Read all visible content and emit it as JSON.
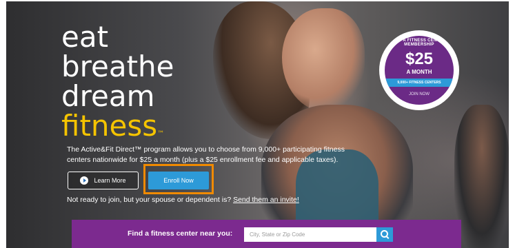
{
  "hero": {
    "headline": {
      "line1": "eat",
      "line2": "breathe",
      "line3": "dream",
      "line4": "fitness",
      "trademark": "™"
    },
    "promo_text": "The Active&Fit Direct™ program allows you to choose from 9,000+ participating fitness centers nationwide for $25 a month (plus a $25 enrollment fee and applicable taxes).",
    "learn_more_label": "Learn More",
    "enroll_label": "Enroll Now",
    "spouse_prefix": "Not ready to join, but your spouse or dependent is?",
    "spouse_link": "Send them an invite!"
  },
  "badge": {
    "arc_text": "GET A FITNESS CENTER MEMBERSHIP",
    "price": "$25",
    "period": "A MONTH",
    "strip_text": "9,000+ FITNESS CENTERS",
    "join_text": "JOIN NOW"
  },
  "finder": {
    "label": "Find a fitness center near you:",
    "placeholder": "City, State or Zip Code"
  },
  "colors": {
    "accent_yellow": "#f5c400",
    "purple": "#7c2a8f",
    "blue": "#2d9ad8",
    "highlight_orange": "#f08a00"
  },
  "icons": {
    "play": "play-icon",
    "search": "search-icon"
  }
}
